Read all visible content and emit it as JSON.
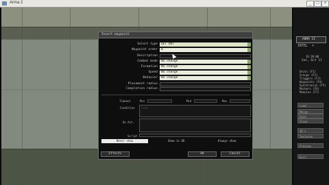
{
  "window": {
    "title": "Arma 2"
  },
  "dialog": {
    "title": "Insert waypoint",
    "fields": [
      {
        "label": "Select type",
        "value": "GET OUT"
      },
      {
        "label": "Waypoint order",
        "value": "0"
      },
      {
        "label": "Description",
        "value": ""
      },
      {
        "label": "Combat mode",
        "value": "No change"
      },
      {
        "label": "Formation",
        "value": "No change"
      },
      {
        "label": "Speed",
        "value": "No change"
      },
      {
        "label": "Behavior",
        "value": "No change"
      },
      {
        "label": "Placement radius",
        "value": ""
      },
      {
        "label": "Completion radius",
        "value": ""
      }
    ],
    "timeout": {
      "label": "Timeout",
      "min": "Min",
      "mid": "Mid",
      "max": "Max"
    },
    "condition": {
      "label": "Condition",
      "value": "true"
    },
    "on_act": {
      "label": "On Act.",
      "value": ""
    },
    "script_label": "Script",
    "show": [
      "Never show",
      "Show in 3D",
      "Always show"
    ],
    "buttons": {
      "effects": "Effects",
      "ok": "OK",
      "cancel": "Cancel"
    }
  },
  "side_panel": {
    "logo": "ARMA II",
    "mode": "INTEL",
    "time": "16:20:00",
    "date": "Sat, Oct 11",
    "modes": [
      "Units (F1)",
      "Groups (F2)",
      "Triggers (F3)",
      "Waypoints (F4)",
      "Synchronize (F5)",
      "Markers (F6)",
      "Modules (F7)"
    ],
    "buttons": [
      "Load",
      "Merge",
      "Save",
      "Clear",
      "ID's",
      "Textures",
      "Preview",
      "Exit"
    ]
  }
}
